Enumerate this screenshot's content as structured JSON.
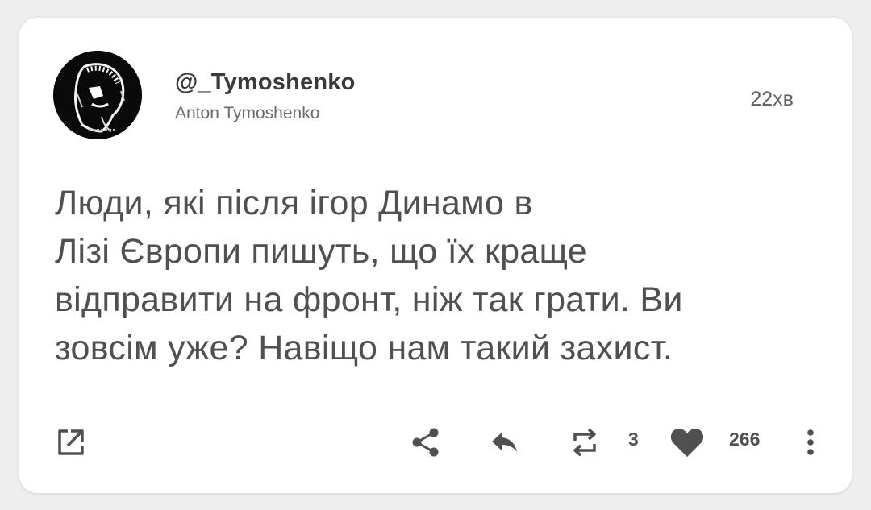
{
  "tweet": {
    "handle": "@_Tymoshenko",
    "display_name": "Anton Tymoshenko",
    "time": "22хв",
    "text_lines": [
      "Люди, які після ігор Динамо в",
      "Лізі Європи пишуть, що їх краще",
      "відправити на фронт, ніж так грати. Ви",
      "зовсім уже? Навіщо нам такий захист."
    ]
  },
  "actions": {
    "open_external_icon": "open-external-icon",
    "share_icon": "share-icon",
    "reply_icon": "reply-icon",
    "retweet_icon": "retweet-icon",
    "retweet_count": "3",
    "like_icon": "heart-icon",
    "like_count": "266",
    "more_icon": "more-vertical-icon"
  },
  "colors": {
    "background": "#eeeeee",
    "card": "#ffffff",
    "text": "#505050",
    "icon": "#505050"
  }
}
